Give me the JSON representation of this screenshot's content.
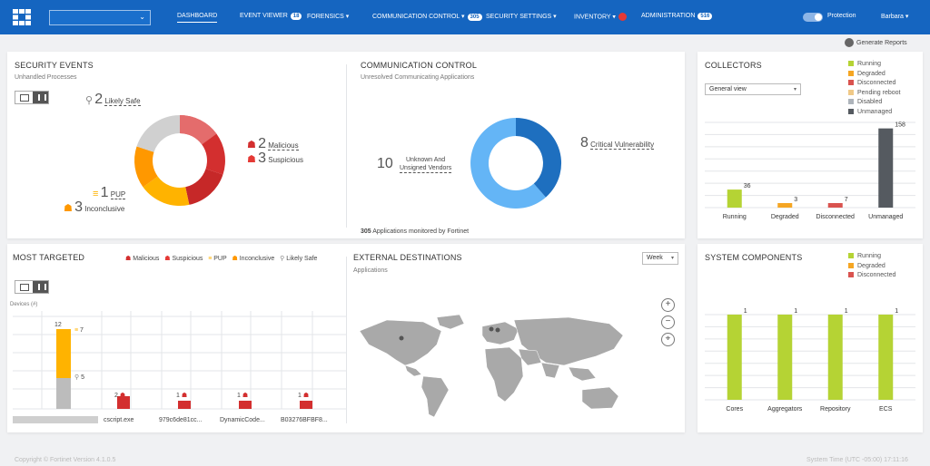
{
  "header": {
    "tenant_placeholder": "",
    "nav": [
      {
        "label": "DASHBOARD"
      },
      {
        "label": "EVENT VIEWER",
        "badge": "18"
      },
      {
        "label": "FORENSICS"
      },
      {
        "label": "COMMUNICATION CONTROL",
        "badge": "305"
      },
      {
        "label": "SECURITY SETTINGS"
      },
      {
        "label": "INVENTORY"
      },
      {
        "label": "ADMINISTRATION",
        "badge": "516"
      }
    ],
    "protection_label": "Protection",
    "user_label": "Barbara",
    "generate_reports": "Generate Reports"
  },
  "security_events": {
    "title": "SECURITY EVENTS",
    "subtitle": "Unhandled Processes",
    "likely_safe_count": "2",
    "likely_safe_label": "Likely Safe",
    "malicious_count": "2",
    "malicious_label": "Malicious",
    "suspicious_count": "3",
    "suspicious_label": "Suspicious",
    "pup_count": "1",
    "pup_label": "PUP",
    "inconclusive_count": "3",
    "inconclusive_label": "Inconclusive",
    "colors": {
      "malicious": "#d32f2f",
      "suspicious": "#e57373",
      "pup": "#ffb300",
      "inconclusive": "#ff9800",
      "likely_safe": "#d0d0d0"
    }
  },
  "communication_control": {
    "title": "COMMUNICATION CONTROL",
    "subtitle": "Unresolved Communicating Applications",
    "unknown_count": "10",
    "unknown_label_1": "Unknown And",
    "unknown_label_2": "Unsigned Vendors",
    "critical_count": "8",
    "critical_label": "Critical Vulnerability",
    "monitored_count": "305",
    "monitored_label": "Applications monitored by Fortinet",
    "colors": {
      "unknown": "#64b5f6",
      "critical": "#1e6fbf"
    }
  },
  "collectors": {
    "title": "COLLECTORS",
    "view_select": "General view",
    "legend": [
      {
        "label": "Running",
        "color": "#b5d334"
      },
      {
        "label": "Degraded",
        "color": "#f5a623"
      },
      {
        "label": "Disconnected",
        "color": "#d9534f"
      },
      {
        "label": "Pending reboot",
        "color": "#f0c987"
      },
      {
        "label": "Disabled",
        "color": "#aeb4bb"
      },
      {
        "label": "Unmanaged",
        "color": "#555a60"
      }
    ]
  },
  "most_targeted": {
    "title": "MOST TARGETED",
    "legend": [
      {
        "label": "Malicious"
      },
      {
        "label": "Suspicious"
      },
      {
        "label": "PUP"
      },
      {
        "label": "Inconclusive"
      },
      {
        "label": "Likely Safe"
      }
    ],
    "axis_label": "Devices (#)",
    "stack_total": "12",
    "stack_upper": "7",
    "stack_lower": "5",
    "targets": [
      "cscript.exe",
      "979c6de81cc...",
      "DynamicCode...",
      "B03276BFBF8..."
    ],
    "target_counts": [
      "2",
      "1",
      "1",
      "1"
    ]
  },
  "external_destinations": {
    "title": "EXTERNAL DESTINATIONS",
    "subtitle": "Applications",
    "period": "Week"
  },
  "system_components": {
    "title": "SYSTEM COMPONENTS",
    "legend": [
      {
        "label": "Running",
        "color": "#b5d334"
      },
      {
        "label": "Degraded",
        "color": "#f5a623"
      },
      {
        "label": "Disconnected",
        "color": "#d9534f"
      }
    ]
  },
  "footer": {
    "copyright": "Copyright © Fortinet Version 4.1.0.5",
    "system_time": "System Time (UTC -05:00) 17:11:16"
  },
  "chart_data": [
    {
      "type": "bar",
      "title": "COLLECTORS",
      "categories": [
        "Running",
        "Degraded",
        "Disconnected",
        "Unmanaged"
      ],
      "values": [
        36,
        3,
        7,
        158
      ],
      "colors": [
        "#b5d334",
        "#f5a623",
        "#d9534f",
        "#555a60"
      ],
      "ylim": [
        0,
        170
      ]
    },
    {
      "type": "bar",
      "title": "SYSTEM COMPONENTS",
      "categories": [
        "Cores",
        "Aggregators",
        "Repository",
        "ECS"
      ],
      "values": [
        1,
        1,
        1,
        1
      ],
      "colors": [
        "#b5d334",
        "#b5d334",
        "#b5d334",
        "#b5d334"
      ],
      "ylim": [
        0,
        1
      ]
    }
  ]
}
